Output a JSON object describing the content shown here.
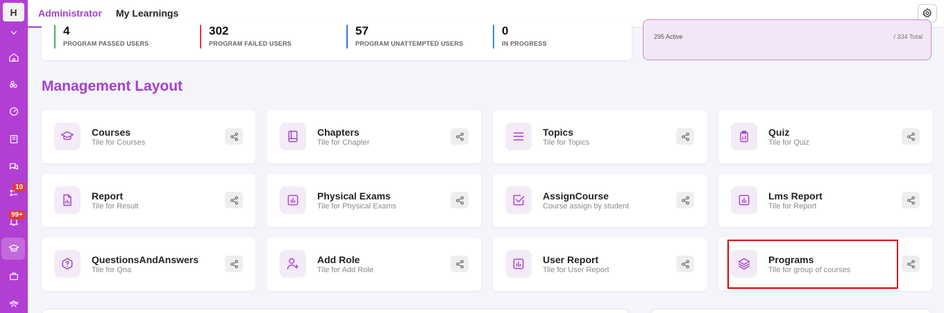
{
  "sidebar": {
    "logo": "H",
    "badges": {
      "reports": "10",
      "notifications": "99+"
    }
  },
  "tabs": [
    {
      "label": "Administrator",
      "active": true
    },
    {
      "label": "My Learnings",
      "active": false
    }
  ],
  "stats": [
    {
      "value": "4",
      "label": "PROGRAM PASSED USERS",
      "color": "#4caf50"
    },
    {
      "value": "302",
      "label": "PROGRAM FAILED USERS",
      "color": "#e53935"
    },
    {
      "value": "57",
      "label": "PROGRAM UNATTEMPTED USERS",
      "color": "#3f6fd8"
    },
    {
      "value": "0",
      "label": "IN PROGRESS",
      "color": "#2a8fd6"
    }
  ],
  "active_card": {
    "active": "295 Active",
    "total": "/ 334 Total"
  },
  "section_title": "Management Layout",
  "tiles": [
    {
      "title": "Courses",
      "subtitle": "Tile for Courses",
      "icon": "graduation-cap-icon"
    },
    {
      "title": "Chapters",
      "subtitle": "Tile for Chapter",
      "icon": "book-icon"
    },
    {
      "title": "Topics",
      "subtitle": "Tile for Topics",
      "icon": "list-icon"
    },
    {
      "title": "Quiz",
      "subtitle": "Tile for Quiz",
      "icon": "clipboard-icon"
    },
    {
      "title": "Report",
      "subtitle": "Tile for Result",
      "icon": "report-file-icon"
    },
    {
      "title": "Physical Exams",
      "subtitle": "Tile for Physical Exams",
      "icon": "chart-box-icon"
    },
    {
      "title": "AssignCourse",
      "subtitle": "Course assign by student",
      "icon": "check-square-icon"
    },
    {
      "title": "Lms Report",
      "subtitle": "Tile for Report",
      "icon": "chart-box-icon"
    },
    {
      "title": "QuestionsAndAnswers",
      "subtitle": "Tile for Qna",
      "icon": "question-shield-icon"
    },
    {
      "title": "Add Role",
      "subtitle": "Tile for Add Role",
      "icon": "user-plus-icon"
    },
    {
      "title": "User Report",
      "subtitle": "Tile for User Report",
      "icon": "chart-box-icon"
    },
    {
      "title": "Programs",
      "subtitle": "Tile for group of courses",
      "icon": "layers-icon"
    }
  ],
  "accent_color": "#a53fcf",
  "sidebar_color": "#b23fd3"
}
